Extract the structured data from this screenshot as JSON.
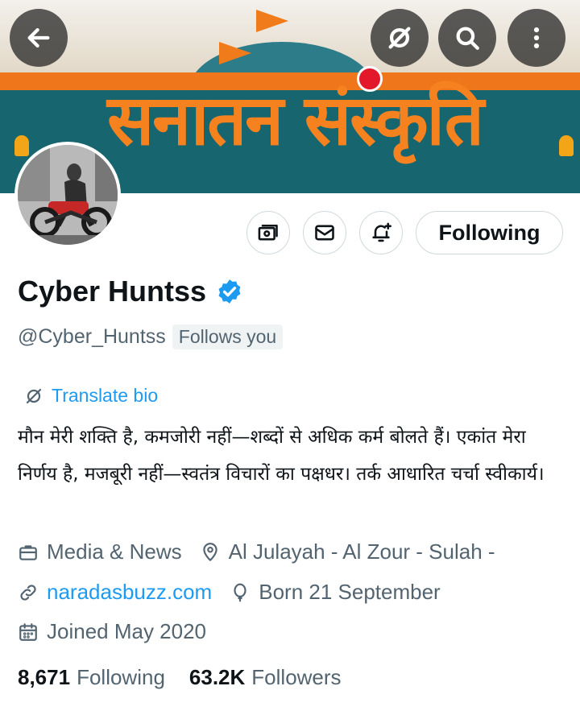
{
  "banner": {
    "tagline": "सनातन संस्कृति",
    "colors": {
      "saffron": "#f07b1a",
      "teal": "#16656f"
    }
  },
  "top_buttons": {
    "back_icon": "arrow-left-icon",
    "grok_icon": "grok-icon",
    "search_icon": "search-icon",
    "more_icon": "more-vertical-icon"
  },
  "actions": {
    "subscribe_icon": "money-icon",
    "message_icon": "envelope-icon",
    "notify_icon": "bell-plus-icon",
    "follow_label": "Following"
  },
  "profile": {
    "name": "Cyber Huntss",
    "verified": true,
    "handle": "@Cyber_Huntss",
    "follows_you": "Follows you",
    "translate_label": "Translate bio",
    "bio": "मौन मेरी शक्ति है, कमजोरी नहीं—शब्दों से अधिक कर्म बोलते हैं। एकांत मेरा निर्णय है, मजबूरी नहीं—स्वतंत्र विचारों का पक्षधर। तर्क आधारित चर्चा स्वीकार्य।",
    "category": "Media & News",
    "location": "Al Julayah - Al Zour - Sulah -",
    "website": "naradasbuzz.com",
    "born": "Born 21 September",
    "joined": "Joined May 2020"
  },
  "stats": {
    "following_count": "8,671",
    "following_label": "Following",
    "followers_count": "63.2K",
    "followers_label": "Followers"
  },
  "colors": {
    "accent": "#1d9bf0",
    "text": "#0f1419",
    "secondary": "#536471"
  }
}
